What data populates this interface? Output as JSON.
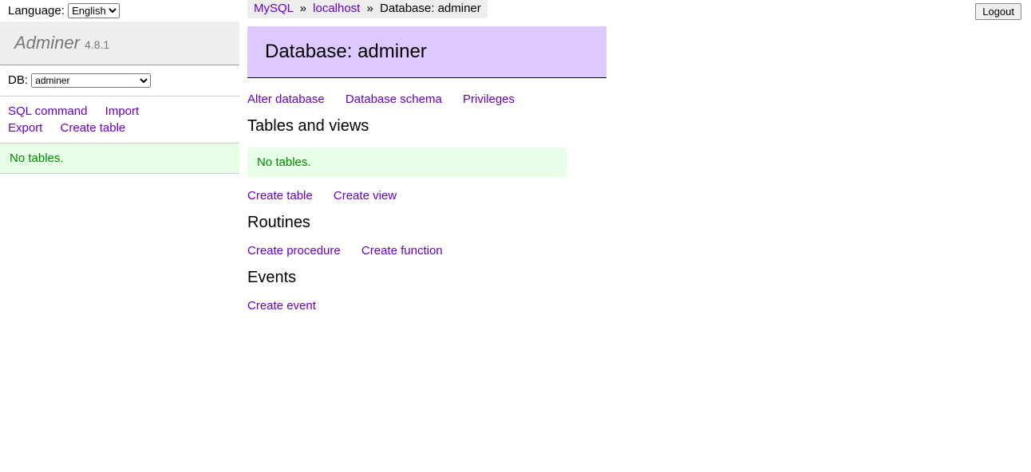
{
  "sidebar": {
    "language_label": "Language:",
    "language_value": "English",
    "app_name": "Adminer",
    "app_version": "4.8.1",
    "db_label": "DB:",
    "db_value": "adminer",
    "links": {
      "sql_command": "SQL command",
      "import": "Import",
      "export": "Export",
      "create_table": "Create table"
    },
    "no_tables": "No tables."
  },
  "breadcrumb": {
    "server_type": "MySQL",
    "host": "localhost",
    "current": "Database: adminer",
    "sep": "»"
  },
  "logout_label": "Logout",
  "main": {
    "title": "Database: adminer",
    "top_links": {
      "alter_db": "Alter database",
      "db_schema": "Database schema",
      "privileges": "Privileges"
    },
    "tables_heading": "Tables and views",
    "no_tables_msg": "No tables.",
    "tables_links": {
      "create_table": "Create table",
      "create_view": "Create view"
    },
    "routines_heading": "Routines",
    "routines_links": {
      "create_procedure": "Create procedure",
      "create_function": "Create function"
    },
    "events_heading": "Events",
    "events_links": {
      "create_event": "Create event"
    }
  }
}
